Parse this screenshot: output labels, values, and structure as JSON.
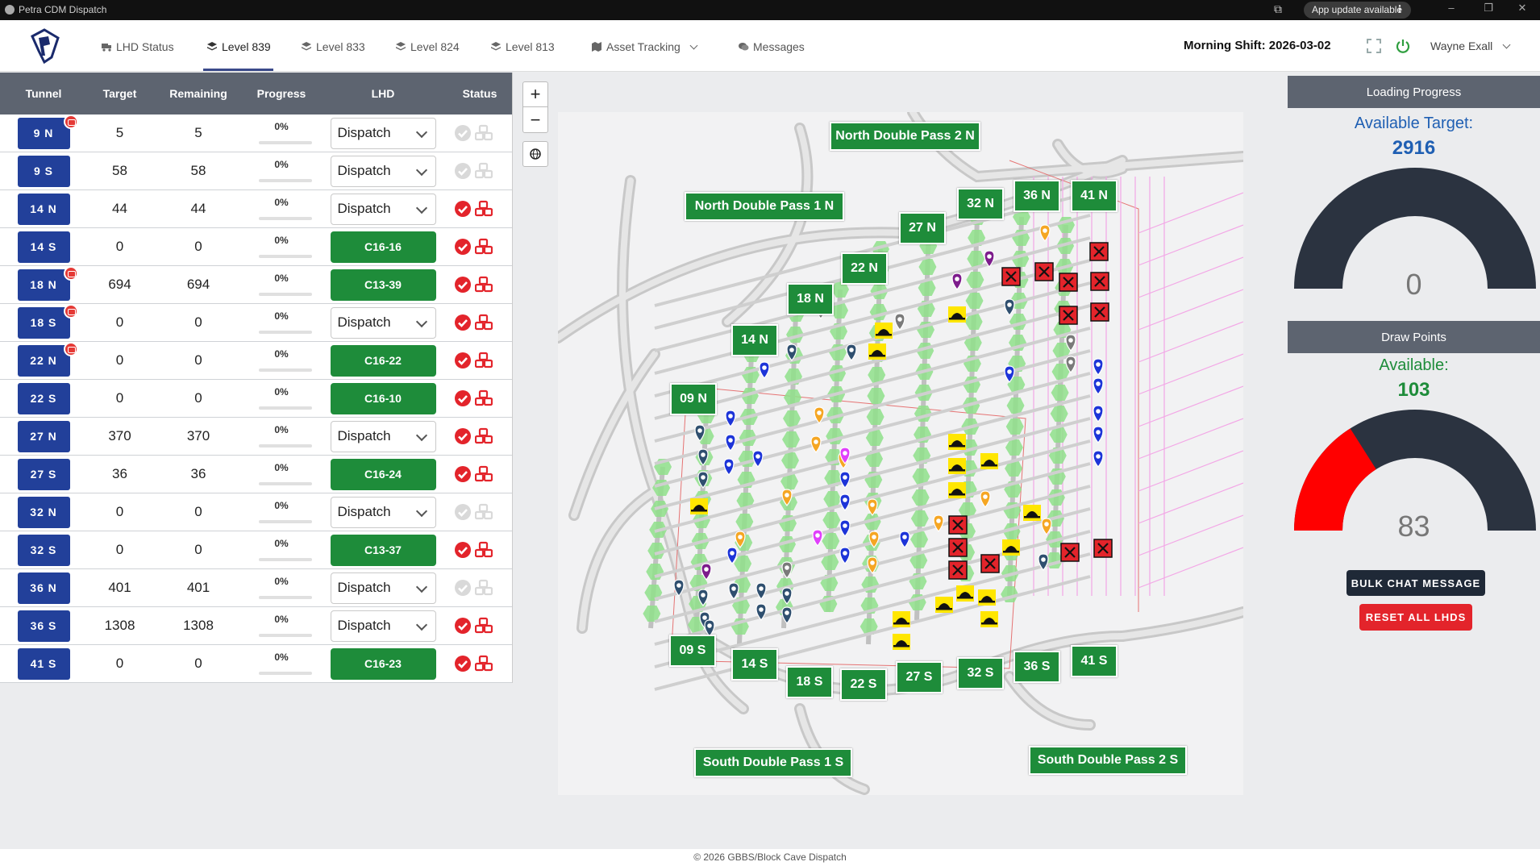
{
  "titlebar": {
    "app_title": "Petra CDM Dispatch",
    "update_label": "App update available"
  },
  "nav": {
    "items": [
      {
        "label": "LHD Status",
        "icon": "truck-icon"
      },
      {
        "label": "Level 839",
        "icon": "layers-icon",
        "active": true
      },
      {
        "label": "Level 833",
        "icon": "layers-icon"
      },
      {
        "label": "Level 824",
        "icon": "layers-icon"
      },
      {
        "label": "Level 813",
        "icon": "layers-icon"
      },
      {
        "label": "Asset Tracking",
        "icon": "map-icon"
      },
      {
        "label": "Messages",
        "icon": "chat-icon"
      }
    ],
    "shift": "Morning Shift: 2026-03-02",
    "user": "Wayne Exall"
  },
  "table": {
    "headers": [
      "Tunnel",
      "Target",
      "Remaining",
      "Progress",
      "LHD",
      "Status"
    ],
    "rows": [
      {
        "tunnel": "9 N",
        "target": "5",
        "remaining": "5",
        "progress": "0%",
        "lhd": "Dispatch",
        "lhd_type": "select",
        "status": "inactive",
        "chat": true
      },
      {
        "tunnel": "9 S",
        "target": "58",
        "remaining": "58",
        "progress": "0%",
        "lhd": "Dispatch",
        "lhd_type": "select",
        "status": "inactive",
        "chat": false
      },
      {
        "tunnel": "14 N",
        "target": "44",
        "remaining": "44",
        "progress": "0%",
        "lhd": "Dispatch",
        "lhd_type": "select",
        "status": "active",
        "chat": false
      },
      {
        "tunnel": "14 S",
        "target": "0",
        "remaining": "0",
        "progress": "0%",
        "lhd": "C16-16",
        "lhd_type": "button",
        "status": "active",
        "chat": false
      },
      {
        "tunnel": "18 N",
        "target": "694",
        "remaining": "694",
        "progress": "0%",
        "lhd": "C13-39",
        "lhd_type": "button",
        "status": "active",
        "chat": true
      },
      {
        "tunnel": "18 S",
        "target": "0",
        "remaining": "0",
        "progress": "0%",
        "lhd": "Dispatch",
        "lhd_type": "select",
        "status": "active",
        "chat": true
      },
      {
        "tunnel": "22 N",
        "target": "0",
        "remaining": "0",
        "progress": "0%",
        "lhd": "C16-22",
        "lhd_type": "button",
        "status": "active",
        "chat": true
      },
      {
        "tunnel": "22 S",
        "target": "0",
        "remaining": "0",
        "progress": "0%",
        "lhd": "C16-10",
        "lhd_type": "button",
        "status": "active",
        "chat": false
      },
      {
        "tunnel": "27 N",
        "target": "370",
        "remaining": "370",
        "progress": "0%",
        "lhd": "Dispatch",
        "lhd_type": "select",
        "status": "active",
        "chat": false
      },
      {
        "tunnel": "27 S",
        "target": "36",
        "remaining": "36",
        "progress": "0%",
        "lhd": "C16-24",
        "lhd_type": "button",
        "status": "active",
        "chat": false
      },
      {
        "tunnel": "32 N",
        "target": "0",
        "remaining": "0",
        "progress": "0%",
        "lhd": "Dispatch",
        "lhd_type": "select",
        "status": "inactive",
        "chat": false
      },
      {
        "tunnel": "32 S",
        "target": "0",
        "remaining": "0",
        "progress": "0%",
        "lhd": "C13-37",
        "lhd_type": "button",
        "status": "active",
        "chat": false
      },
      {
        "tunnel": "36 N",
        "target": "401",
        "remaining": "401",
        "progress": "0%",
        "lhd": "Dispatch",
        "lhd_type": "select",
        "status": "inactive",
        "chat": false
      },
      {
        "tunnel": "36 S",
        "target": "1308",
        "remaining": "1308",
        "progress": "0%",
        "lhd": "Dispatch",
        "lhd_type": "select",
        "status": "active",
        "chat": false
      },
      {
        "tunnel": "41 S",
        "target": "0",
        "remaining": "0",
        "progress": "0%",
        "lhd": "C16-23",
        "lhd_type": "button",
        "status": "active",
        "chat": false
      }
    ]
  },
  "map": {
    "labels": [
      "North Double Pass 2 N",
      "North Double Pass 1 N",
      "32 N",
      "36 N",
      "41 N",
      "27 N",
      "22 N",
      "18 N",
      "14 N",
      "09 N",
      "09 S",
      "14 S",
      "18 S",
      "22 S",
      "27 S",
      "32 S",
      "36 S",
      "41 S",
      "South Double Pass 1 S",
      "South Double Pass 2 S"
    ]
  },
  "panel": {
    "loading_title": "Loading Progress",
    "available_target_label": "Available Target:",
    "available_target_value": "2916",
    "loading_gauge_value": "0",
    "draw_points_title": "Draw Points",
    "available_label": "Available:",
    "available_value": "103",
    "draw_gauge_value": "83",
    "draw_gauge_fraction": 0.32,
    "bulk_chat_label": "BULK CHAT MESSAGE",
    "reset_label": "RESET ALL LHDS"
  },
  "colors": {
    "primary_blue": "#22409a",
    "green": "#1e8c3a",
    "red": "#e3242b",
    "header_grey": "#5d6470",
    "gauge_dark": "#2b3340",
    "available_target_blue": "#1f5fb3",
    "available_green": "#1e8c3a"
  },
  "footer": "© 2026 GBBS/Block Cave Dispatch"
}
